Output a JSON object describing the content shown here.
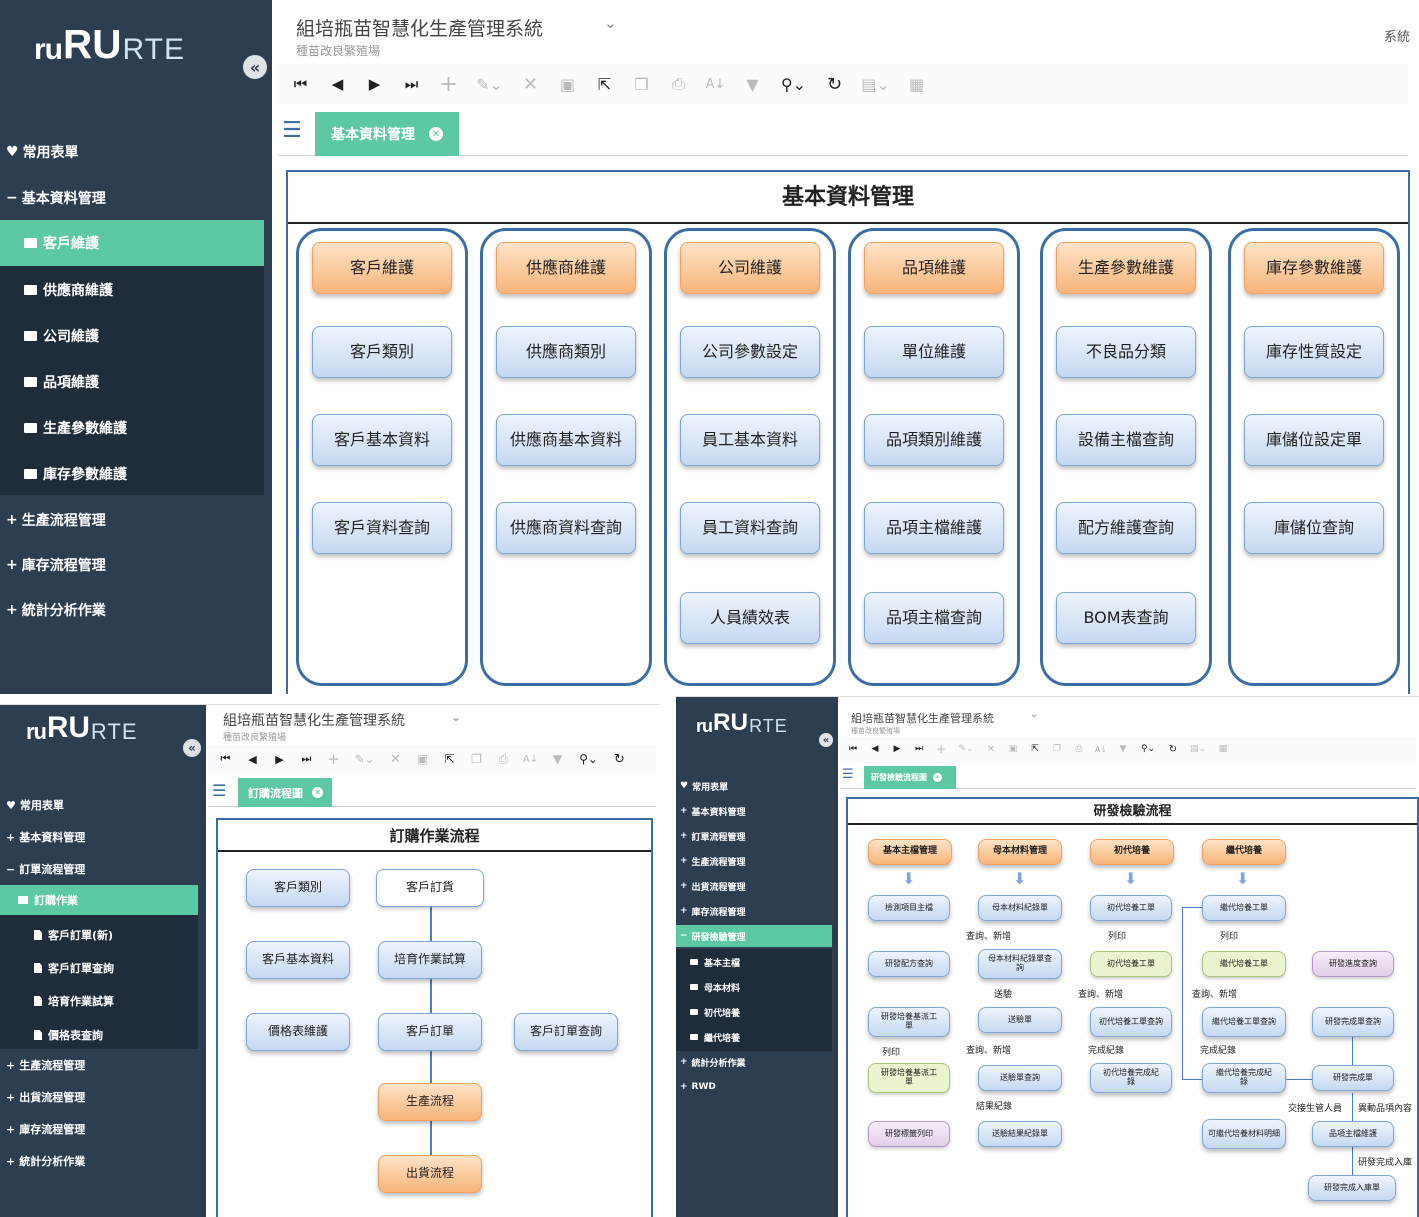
{
  "app_title": "組培瓶苗智慧化生產管理系統",
  "app_subtitle": "種苗改良繁殖場",
  "logo": {
    "part1": "ru",
    "part2": "RU",
    "part3": "RTE"
  },
  "top_right": "系統",
  "collapse_icon": "«",
  "chevron": "⌄",
  "toolbar_icons": [
    "first-icon",
    "prev-icon",
    "next-icon",
    "last-icon",
    "add-icon",
    "edit-icon",
    "delete-icon",
    "save-icon",
    "export-icon",
    "copy-icon",
    "print-icon",
    "sort-icon",
    "filter-icon",
    "search-icon",
    "refresh-icon",
    "layout-icon",
    "report-icon"
  ],
  "screen1": {
    "menu": {
      "favorites": "常用表單",
      "basic": "基本資料管理",
      "customer": "客戶維護",
      "supplier": "供應商維護",
      "company": "公司維護",
      "item": "品項維護",
      "production_param": "生產參數維護",
      "inventory_param": "庫存參數維護",
      "production_flow": "生產流程管理",
      "inventory_flow": "庫存流程管理",
      "stats": "統計分析作業"
    },
    "tab": "基本資料管理",
    "panel_title": "基本資料管理",
    "columns": [
      {
        "header": "客戶維護",
        "items": [
          "客戶類別",
          "客戶基本資料",
          "客戶資料查詢"
        ]
      },
      {
        "header": "供應商維護",
        "items": [
          "供應商類別",
          "供應商基本資料",
          "供應商資料查詢"
        ]
      },
      {
        "header": "公司維護",
        "items": [
          "公司參數設定",
          "員工基本資料",
          "員工資料查詢",
          "人員績效表"
        ]
      },
      {
        "header": "品項維護",
        "items": [
          "單位維護",
          "品項類別維護",
          "品項主檔維護",
          "品項主檔查詢"
        ]
      },
      {
        "header": "生產參數維護",
        "items": [
          "不良品分類",
          "設備主檔查詢",
          "配方維護查詢",
          "BOM表查詢"
        ]
      },
      {
        "header": "庫存參數維護",
        "items": [
          "庫存性質設定",
          "庫儲位設定單",
          "庫儲位查詢"
        ]
      }
    ]
  },
  "screen2": {
    "menu": {
      "favorites": "常用表單",
      "basic": "基本資料管理",
      "order_flow": "訂單流程管理",
      "purchase": "訂購作業",
      "order_new": "客戶訂單(新)",
      "order_query": "客戶訂單查詢",
      "cultivation_calc": "培育作業試算",
      "price_query": "價格表查詢",
      "production_flow": "生產流程管理",
      "shipping_flow": "出貨流程管理",
      "inventory_flow": "庫存流程管理",
      "stats": "統計分析作業"
    },
    "tab": "訂購流程圖",
    "panel_title": "訂購作業流程",
    "nodes": {
      "customer_category": "客戶類別",
      "customer_basic": "客戶基本資料",
      "price_maint": "價格表維護",
      "customer_order_request": "客戶訂貨",
      "cultivation_trial": "培育作業試算",
      "customer_order": "客戶訂單",
      "customer_order_query": "客戶訂單查詢",
      "production_flow": "生產流程",
      "shipping_flow": "出貨流程"
    }
  },
  "screen3": {
    "menu": {
      "favorites": "常用表單",
      "basic": "基本資料管理",
      "order_flow": "訂單流程管理",
      "production_flow": "生產流程管理",
      "shipping_flow": "出貨流程管理",
      "inventory_flow": "庫存流程管理",
      "rd_test": "研發檢驗管理",
      "master": "基本主檔",
      "mother": "母本材料",
      "first_culture": "初代培養",
      "sub_culture": "繼代培養",
      "stats": "統計分析作業",
      "rwd": "RWD"
    },
    "tab": "研發檢驗流程圖",
    "panel_title": "研發檢驗流程",
    "headers": {
      "master_mgmt": "基本主檔管理",
      "mother_mgmt": "母本材料管理",
      "first_culture": "初代培養",
      "sub_culture": "繼代培養"
    },
    "nodes": {
      "test_item_master": "檢測項目主檔",
      "rd_formula_query": "研發配方查詢",
      "rd_work_order": "研發培養基派工單",
      "rd_work_order2": "研發培養基派工單",
      "rd_label_print": "研發標籤列印",
      "mother_record": "母本材料紀錄單",
      "mother_record_query": "母本材料紀錄單查詢",
      "inspection_sheet": "送驗單",
      "inspection_query": "送驗單查詢",
      "inspection_result": "送驗結果紀錄單",
      "first_work_order": "初代培養工單",
      "first_work_order2": "初代培養工單",
      "first_work_query": "初代培養工單查詢",
      "first_complete": "初代培養完成紀錄",
      "sub_work_order": "繼代培養工單",
      "sub_work_order2": "繼代培養工單",
      "sub_work_query": "繼代培養工單查詢",
      "sub_complete": "繼代培養完成紀錄",
      "sub_material_detail": "可繼代培養材料明細",
      "rd_progress": "研發進度查詢",
      "rd_done_query": "研發完成單查詢",
      "rd_done": "研發完成單",
      "item_master": "品項主檔維護",
      "rd_stock_in": "研發完成入庫單"
    },
    "notes": {
      "query_add1": "查詢、新增",
      "print1": "列印",
      "send": "送驗",
      "query_add2": "查詢、新增",
      "result": "結果紀錄",
      "print2": "列印",
      "query_add3": "查詢、新增",
      "complete1": "完成紀錄",
      "print3": "列印",
      "query_add4": "查詢、新增",
      "complete2": "完成紀錄",
      "print4": "列印",
      "handover": "交接生管人員",
      "change_item": "異動品項內容",
      "stock_in": "研發完成入庫"
    }
  }
}
